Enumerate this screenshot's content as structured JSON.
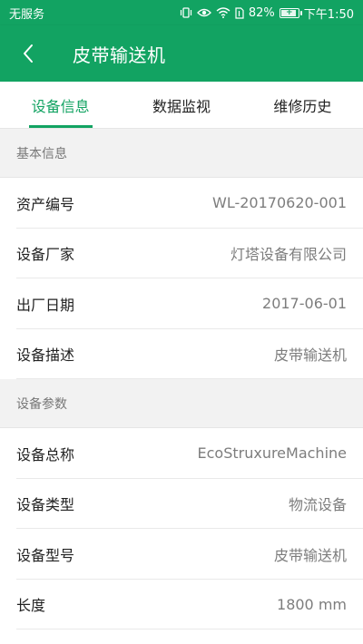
{
  "status_bar": {
    "carrier": "无服务",
    "battery": "82%",
    "time": "下午1:50",
    "icons": [
      "vibrate-icon",
      "eye-icon",
      "wifi-icon",
      "sim-icon",
      "battery-icon"
    ]
  },
  "app_bar": {
    "title": "皮带输送机",
    "back_icon": "chevron-left-icon"
  },
  "tabs": [
    {
      "label": "设备信息",
      "active": true
    },
    {
      "label": "数据监视",
      "active": false
    },
    {
      "label": "维修历史",
      "active": false
    }
  ],
  "sections": [
    {
      "title": "基本信息",
      "rows": [
        {
          "label": "资产编号",
          "value": "WL-20170620-001"
        },
        {
          "label": "设备厂家",
          "value": "灯塔设备有限公司"
        },
        {
          "label": "出厂日期",
          "value": "2017-06-01"
        },
        {
          "label": "设备描述",
          "value": "皮带输送机"
        }
      ]
    },
    {
      "title": "设备参数",
      "rows": [
        {
          "label": "设备总称",
          "value": "EcoStruxureMachine"
        },
        {
          "label": "设备类型",
          "value": "物流设备"
        },
        {
          "label": "设备型号",
          "value": "皮带输送机"
        },
        {
          "label": "长度",
          "value": "1800 mm"
        }
      ]
    }
  ],
  "colors": {
    "primary": "#12a362",
    "section_bg": "#f2f2f2",
    "label": "#222222",
    "value": "#7d7d7d"
  }
}
